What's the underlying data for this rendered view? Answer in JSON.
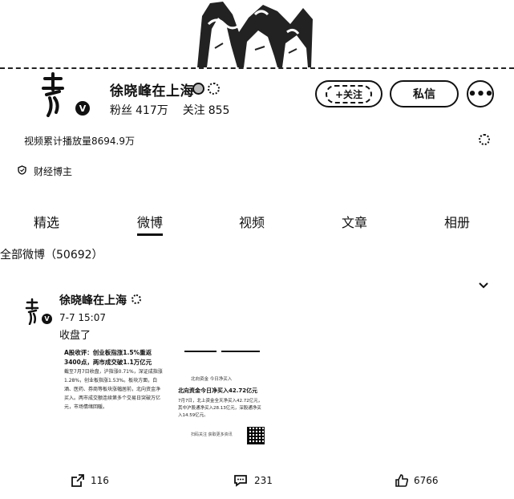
{
  "profile": {
    "name": "徐晓峰在上海",
    "followers_label": "粉丝",
    "followers": "417万",
    "following_label": "关注",
    "following": "855",
    "follow_button": "+关注",
    "message_button": "私信",
    "more_button": "•••",
    "play_count": "视频累计播放量8694.9万",
    "tag": "财经博主"
  },
  "tabs": [
    "精选",
    "微博",
    "视频",
    "文章",
    "相册"
  ],
  "active_tab": "微博",
  "feed": {
    "all_posts": "全部微博（50692）"
  },
  "post": {
    "author": "徐晓峰在上海",
    "time": "7-7 15:07",
    "text": "收盘了",
    "image1": {
      "title": "A股收评：创业板指涨1.5%重返3400点，两市成交破1.1万亿元",
      "body": "截至7月7日收盘，沪指涨0.71%，深证成指涨1.28%，创业板指涨1.53%。板块方面，白酒、医药、券商等板块涨幅居前，北向资金净买入。两市成交额连续第多个交易日突破万亿元，市场情绪回暖。"
    },
    "image2": {
      "small": "北向资金 今日净买入",
      "head": "北向资金今日净买入42.72亿元",
      "body": "7月7日，北上资金全天净买入42.72亿元，其中沪股通净买入28.13亿元，深股通净买入14.59亿元。",
      "foot": "扫码关注 获取更多资讯"
    },
    "shares": "116",
    "comments": "231",
    "likes": "6766"
  },
  "icons": {
    "share": "share-icon",
    "comment": "comment-icon",
    "like": "thumbs-up-icon"
  }
}
